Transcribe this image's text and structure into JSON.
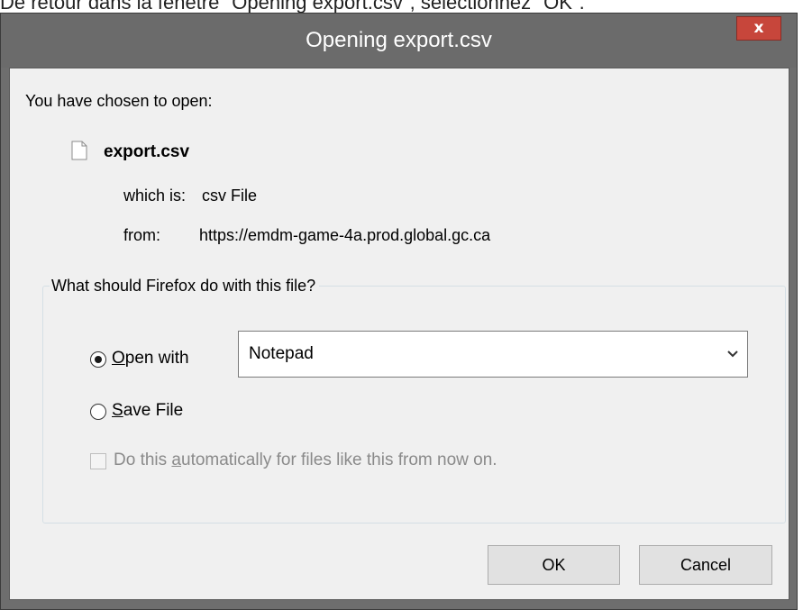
{
  "background_caption": "De retour dans la fenêtre \"Opening export.csv\", sélectionnez \"OK\".",
  "dialog": {
    "title": "Opening export.csv",
    "close_label": "x",
    "intro": "You have chosen to open:",
    "file_icon": "document-icon",
    "file_name": "export.csv",
    "which_label": "which is:",
    "which_value": "csv File",
    "from_label": "from:",
    "from_value": "https://emdm-game-4a.prod.global.gc.ca",
    "group_label": "What should Firefox do with this file?",
    "open_with": {
      "mnemonic": "O",
      "rest": "pen with",
      "selected": true,
      "app": "Notepad"
    },
    "save_file": {
      "mnemonic": "S",
      "rest": "ave File",
      "selected": false
    },
    "auto": {
      "prefix": "Do this ",
      "mnemonic": "a",
      "rest": "utomatically for files like this from now on.",
      "checked": false,
      "enabled": false
    },
    "buttons": {
      "ok": "OK",
      "cancel": "Cancel"
    }
  },
  "colors": {
    "titlebar": "#6b6b6b",
    "close_button": "#c7463b",
    "dialog_body": "#f0f0f0"
  }
}
